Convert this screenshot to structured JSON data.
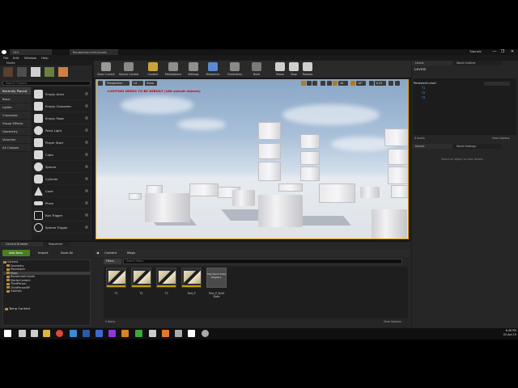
{
  "window": {
    "tab_label": "UE4",
    "tab2_label": "RandomizerLimit/Levels",
    "right_label": "Tutorials",
    "win_buttons": [
      "—",
      "❐",
      "✕"
    ]
  },
  "menu": [
    "File",
    "Edit",
    "Window",
    "Help"
  ],
  "modes": {
    "header": "Modes",
    "search_placeholder": "Search Classes",
    "categories": [
      "Recently Placed",
      "Basic",
      "Lights",
      "Cinematic",
      "Visual Effects",
      "Geometry",
      "Volumes",
      "All Classes"
    ],
    "selected_category": "Recently Placed",
    "place_items": [
      "Empty Actor",
      "Empty Character",
      "Empty Pawn",
      "Point Light",
      "Player Start",
      "Cube",
      "Sphere",
      "Cylinder",
      "Cone",
      "Plane",
      "Box Trigger",
      "Sphere Trigger"
    ]
  },
  "toolbar": {
    "buttons": [
      {
        "label": "Save Current",
        "icon": "save-icon",
        "color": "#9a9a9a"
      },
      {
        "label": "Source Control",
        "icon": "source-control-icon",
        "color": "#8a8a8a"
      },
      {
        "label": "Content",
        "icon": "content-icon",
        "color": "#c9a43a"
      },
      {
        "label": "Marketplace",
        "icon": "marketplace-icon",
        "color": "#8e8e8e"
      },
      {
        "label": "Settings",
        "icon": "settings-icon",
        "color": "#8f8f8f"
      },
      {
        "label": "Blueprints",
        "icon": "blueprints-icon",
        "color": "#5a8ad0"
      },
      {
        "label": "Cinematics",
        "icon": "cinematics-icon",
        "color": "#8a8a8a"
      },
      {
        "label": "Build",
        "icon": "build-icon",
        "color": "#7a7a7a"
      },
      {
        "label": "Pause",
        "icon": "pause-icon",
        "color": "#d0d0d0"
      },
      {
        "label": "Stop",
        "icon": "stop-icon",
        "color": "#d0d0d0"
      },
      {
        "label": "Possess",
        "icon": "possess-icon",
        "color": "#d0d0d0"
      }
    ]
  },
  "viewport": {
    "perspective_label": "Perspective",
    "lit_label": "Lit",
    "show_label": "Show",
    "warning": "LIGHTING NEEDS TO BE REBUILT (166 unbuilt objects)",
    "snap_values": [
      "10",
      "10°",
      "0.25"
    ]
  },
  "levels": {
    "tab_levels": "Levels",
    "tab_outliner": "World Outliner",
    "title": "Levels",
    "rows": [
      "Persistent Level",
      "T1",
      "T2",
      "T3"
    ],
    "count": "4 levels",
    "view_options": "View Options"
  },
  "details": {
    "tab_details": "Details",
    "tab_world": "World Settings",
    "message": "Select an object to view details."
  },
  "content_browser": {
    "tab_label": "Content Browser",
    "tab2_label": "Sequencer",
    "add_new": "Add New",
    "import": "Import",
    "save_all": "Save All",
    "crumbs": [
      "Content",
      "Maps"
    ],
    "filters": "Filters",
    "search_placeholder": "Search Maps",
    "tree": [
      "Content",
      "Geometry",
      "Mannequin",
      "Maps",
      "RandomizerLevels",
      "StarterContent",
      "ThirdPerson",
      "ThirdPersonBP",
      "Tutorials"
    ],
    "temp_content": "Temp Content",
    "assets": [
      "T1",
      "T2",
      "T3",
      "Test_P"
    ],
    "mapbuild_label": "Map Build Data Registry",
    "mapbuild_name": "Test_P_Built Data",
    "items_count": "5 items",
    "view_options": "View Options"
  },
  "taskbar": {
    "time": "6:48 PM",
    "date": "02-Apr-19",
    "icons": [
      {
        "name": "windows-start-icon",
        "color": "#ffffff"
      },
      {
        "name": "search-icon",
        "color": "#cccccc"
      },
      {
        "name": "task-view-icon",
        "color": "#cccccc"
      },
      {
        "name": "file-explorer-icon",
        "color": "#e2b43a"
      },
      {
        "name": "chrome-icon",
        "color": "#e0463a"
      },
      {
        "name": "store-icon",
        "color": "#3a8ad8"
      },
      {
        "name": "word-icon",
        "color": "#2b5aa8"
      },
      {
        "name": "photoshop-icon",
        "color": "#3a6ad0"
      },
      {
        "name": "premiere-icon",
        "color": "#8a3ad8"
      },
      {
        "name": "illustrator-icon",
        "color": "#d8802a"
      },
      {
        "name": "epic-launcher-icon",
        "color": "#3aa83a"
      },
      {
        "name": "media-icon",
        "color": "#cccccc"
      },
      {
        "name": "blender-icon",
        "color": "#e07a2a"
      },
      {
        "name": "app-icon",
        "color": "#aaaaaa"
      },
      {
        "name": "unreal-icon",
        "color": "#ffffff"
      },
      {
        "name": "app2-icon",
        "color": "#aaaaaa"
      }
    ]
  }
}
